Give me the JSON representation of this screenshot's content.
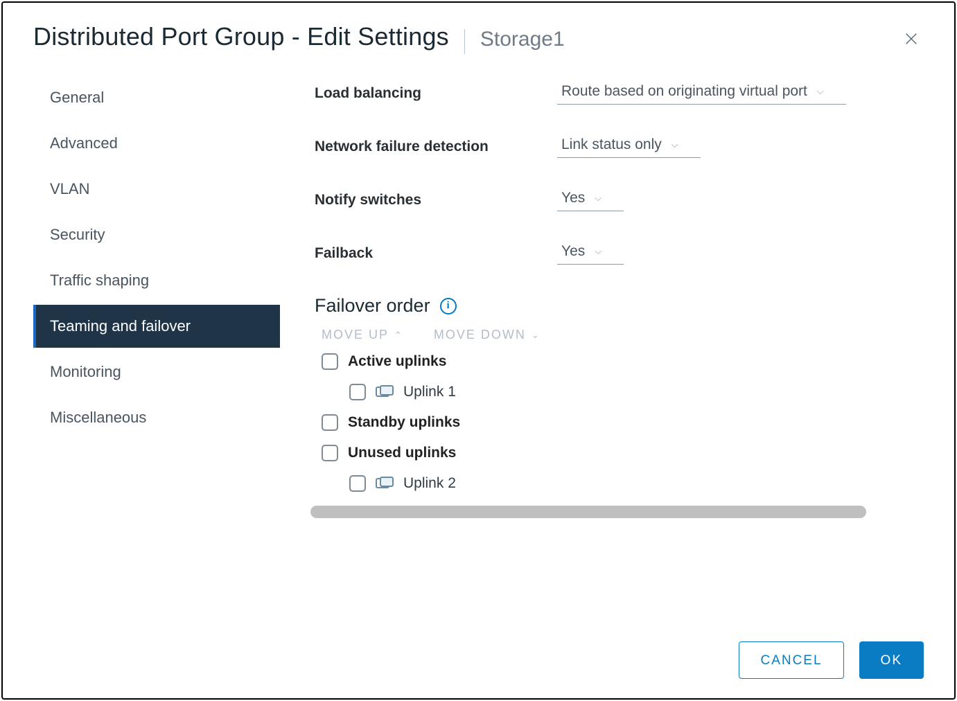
{
  "modal": {
    "title": "Distributed Port Group - Edit Settings",
    "context": "Storage1"
  },
  "sidebar": {
    "items": [
      {
        "label": "General"
      },
      {
        "label": "Advanced"
      },
      {
        "label": "VLAN"
      },
      {
        "label": "Security"
      },
      {
        "label": "Traffic shaping"
      },
      {
        "label": "Teaming and failover"
      },
      {
        "label": "Monitoring"
      },
      {
        "label": "Miscellaneous"
      }
    ],
    "active_index": 5
  },
  "form": {
    "load_balancing": {
      "label": "Load balancing",
      "value": "Route based on originating virtual port"
    },
    "failure_detection": {
      "label": "Network failure detection",
      "value": "Link status only"
    },
    "notify_switches": {
      "label": "Notify switches",
      "value": "Yes"
    },
    "failback": {
      "label": "Failback",
      "value": "Yes"
    }
  },
  "failover": {
    "title": "Failover order",
    "move_up": "MOVE UP",
    "move_down": "MOVE DOWN",
    "groups": {
      "active": {
        "label": "Active uplinks",
        "items": [
          {
            "label": "Uplink 1"
          }
        ]
      },
      "standby": {
        "label": "Standby uplinks",
        "items": []
      },
      "unused": {
        "label": "Unused uplinks",
        "items": [
          {
            "label": "Uplink 2"
          }
        ]
      }
    }
  },
  "footer": {
    "cancel": "CANCEL",
    "ok": "OK"
  }
}
